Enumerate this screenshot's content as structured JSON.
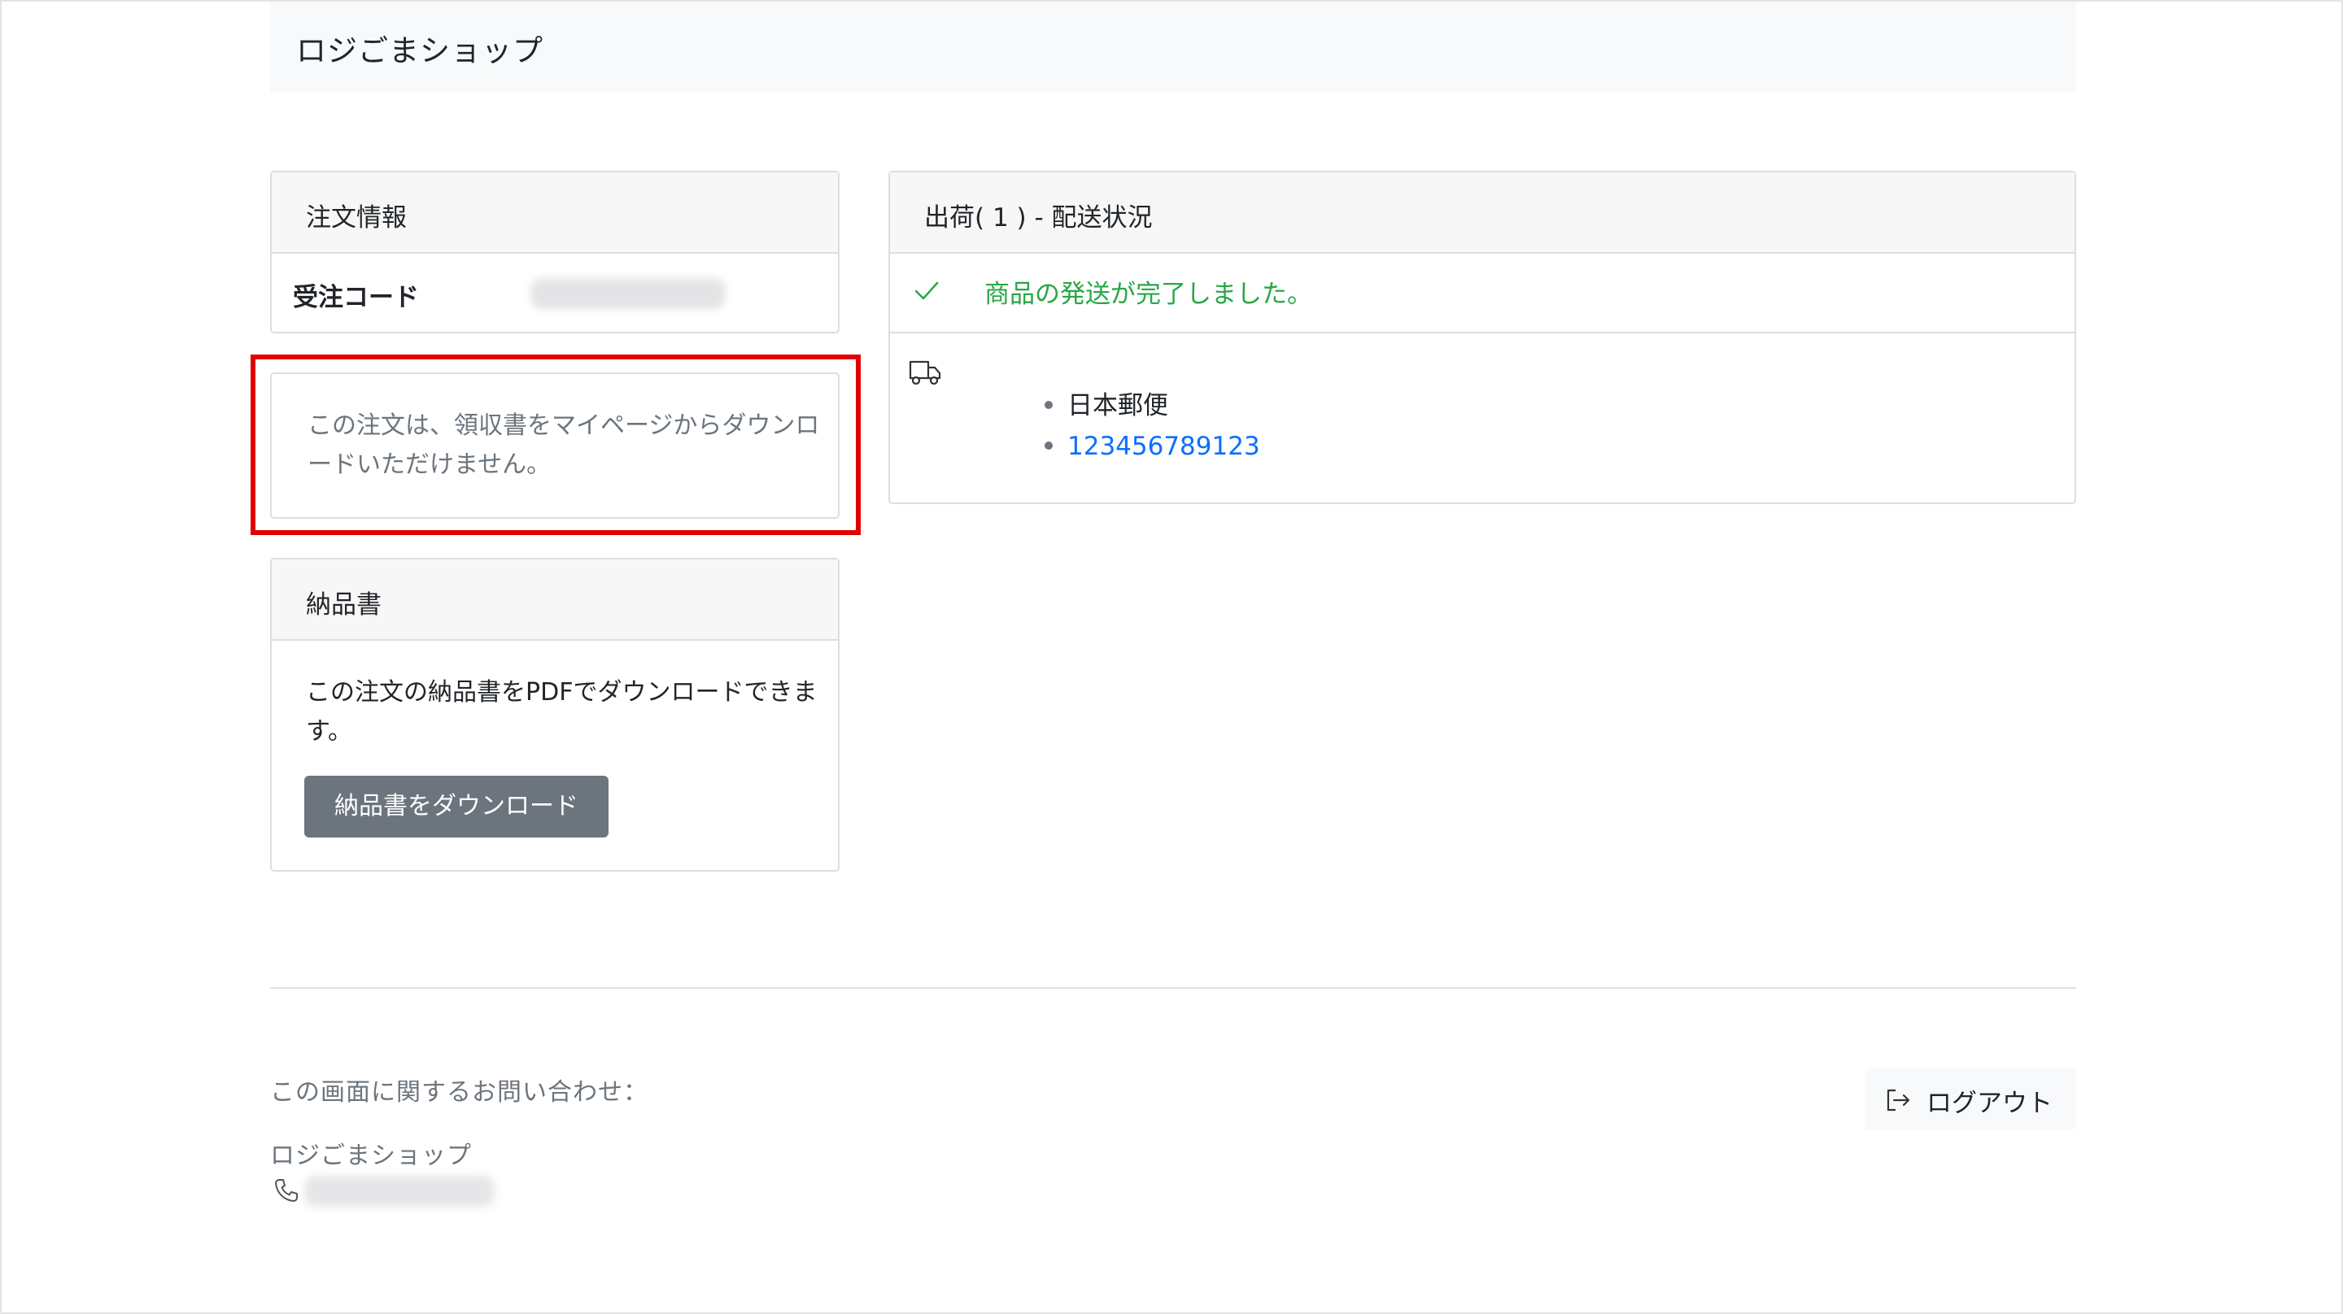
{
  "header": {
    "brand": "ロジごまショップ"
  },
  "order_info": {
    "title": "注文情報",
    "code_label": "受注コード"
  },
  "receipt_note": {
    "text": "この注文は、領収書をマイページからダウンロードいただけません。"
  },
  "delivery_slip": {
    "title": "納品書",
    "description": "この注文の納品書をPDFでダウンロードできます。",
    "button_label": "納品書をダウンロード"
  },
  "shipment": {
    "title": "出荷( 1 ) - 配送状況",
    "status": "商品の発送が完了しました。",
    "carrier": "日本郵便",
    "tracking_number": "123456789123"
  },
  "footer": {
    "contact_lead": "この画面に関するお問い合わせ：",
    "shop_name": "ロジごまショップ",
    "logout_label": "ログアウト"
  },
  "colors": {
    "status_green": "#28a745",
    "link_blue": "#0d6efd",
    "button_gray": "#6c757d",
    "highlight_red": "#e00000"
  },
  "icons": [
    "check-icon",
    "truck-icon",
    "phone-icon",
    "logout-icon"
  ]
}
